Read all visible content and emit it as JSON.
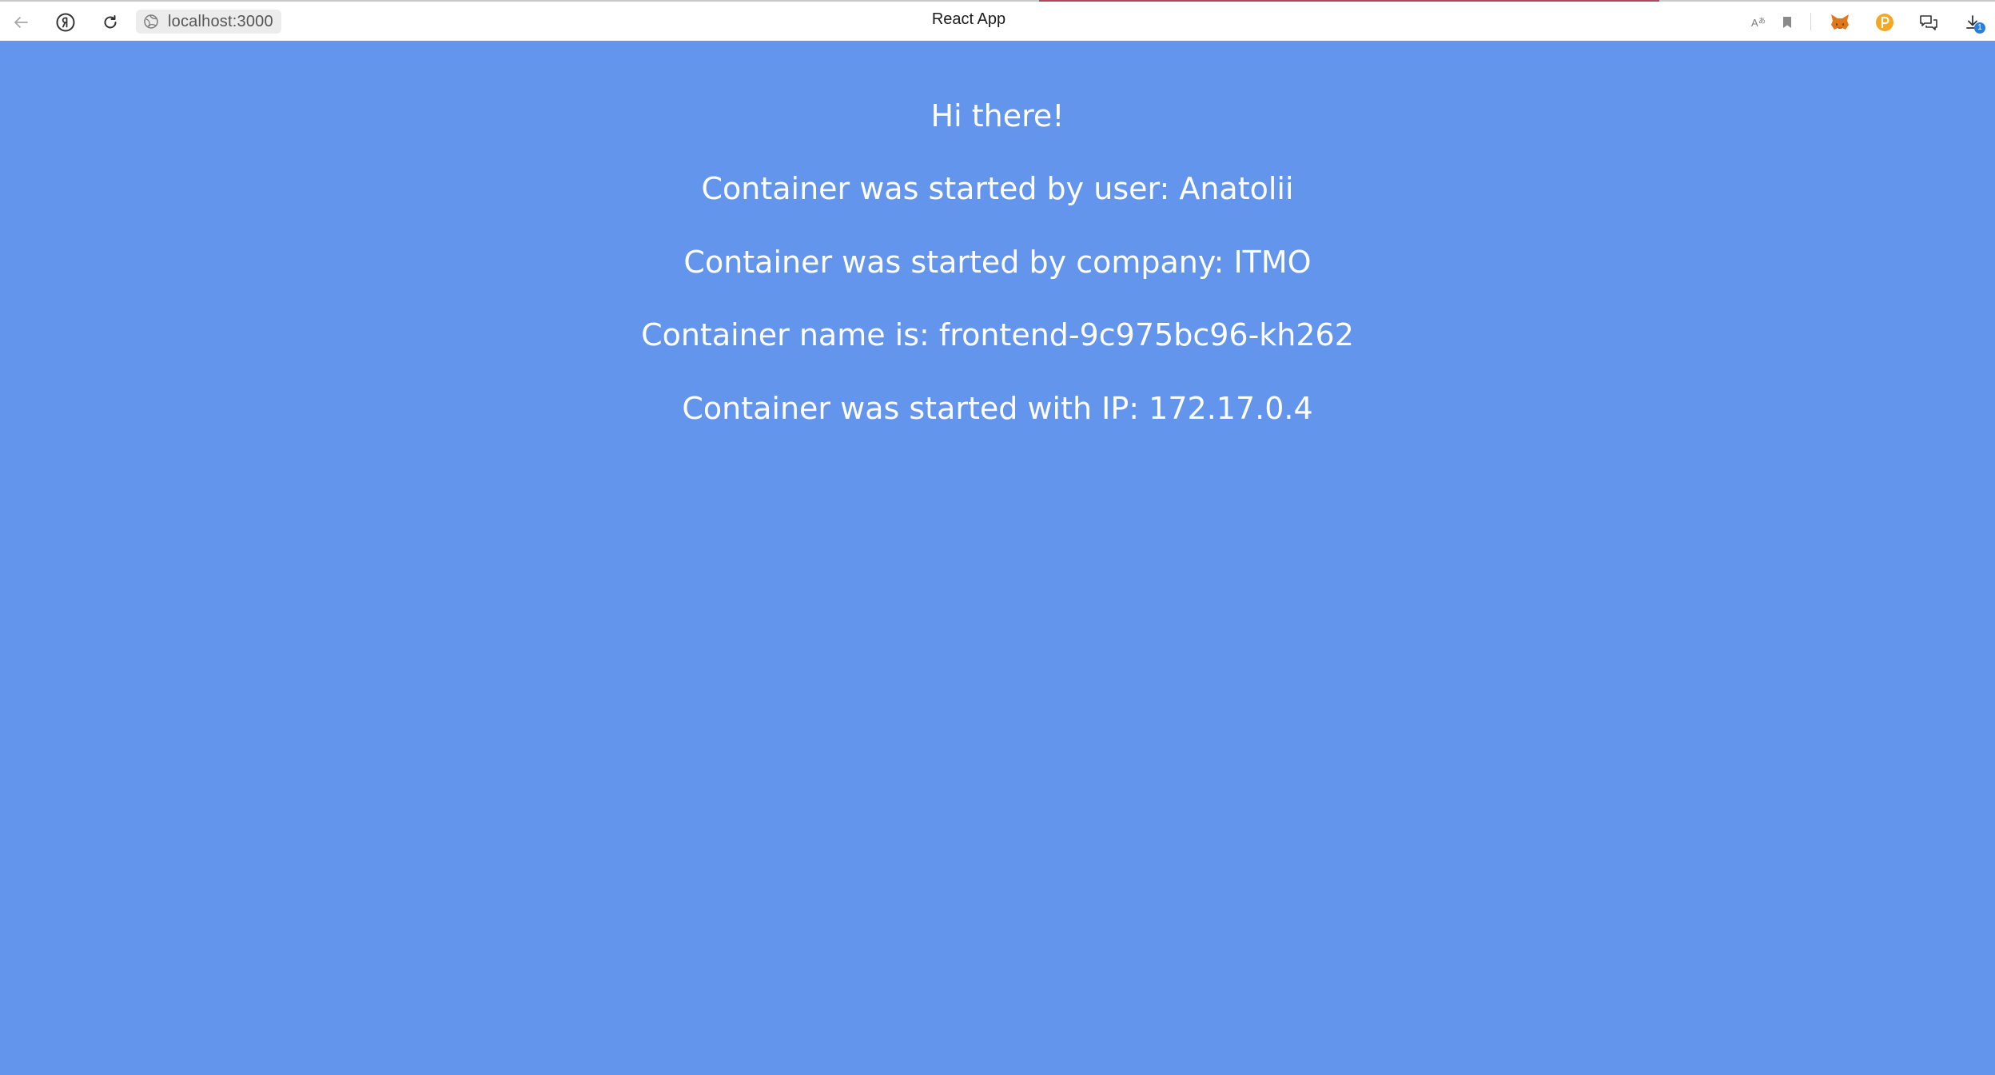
{
  "browser": {
    "url": "localhost:3000",
    "tab_title": "React App",
    "download_badge": "1",
    "icons": {
      "back": "back-arrow-icon",
      "yandex": "yandex-logo-icon",
      "reload": "reload-icon",
      "site": "site-info-icon",
      "translate": "translate-icon",
      "bookmark": "bookmark-icon",
      "metamask": "metamask-fox-icon",
      "coin": "coin-extension-icon",
      "chat": "chat-icon",
      "download": "download-icon"
    }
  },
  "page": {
    "background_color": "#6495ed",
    "text_color": "#ffffff",
    "lines": [
      "Hi there!",
      "Container was started by user: Anatolii",
      "Container was started by company: ITMO",
      "Container name is: frontend-9c975bc96-kh262",
      "Container was started with IP: 172.17.0.4"
    ]
  }
}
